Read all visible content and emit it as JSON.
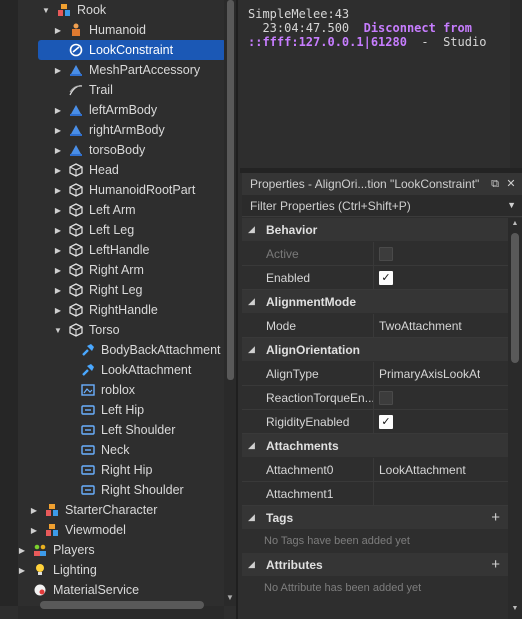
{
  "explorer": {
    "items": [
      {
        "label": "Rook",
        "arrow": "down",
        "icon": "model-icon",
        "indent": 56
      },
      {
        "label": "Humanoid",
        "arrow": "right",
        "icon": "humanoid-icon",
        "indent": 68
      },
      {
        "label": "LookConstraint",
        "arrow": "",
        "icon": "constraint-icon",
        "indent": 68,
        "selected": true
      },
      {
        "label": "MeshPartAccessory",
        "arrow": "right",
        "icon": "accessory-icon",
        "indent": 68
      },
      {
        "label": "Trail",
        "arrow": "",
        "icon": "trail-icon",
        "indent": 68
      },
      {
        "label": "leftArmBody",
        "arrow": "right",
        "icon": "accessory-icon",
        "indent": 68
      },
      {
        "label": "rightArmBody",
        "arrow": "right",
        "icon": "accessory-icon",
        "indent": 68
      },
      {
        "label": "torsoBody",
        "arrow": "right",
        "icon": "accessory-icon",
        "indent": 68
      },
      {
        "label": "Head",
        "arrow": "right",
        "icon": "part-icon",
        "indent": 68
      },
      {
        "label": "HumanoidRootPart",
        "arrow": "right",
        "icon": "part-icon",
        "indent": 68
      },
      {
        "label": "Left Arm",
        "arrow": "right",
        "icon": "part-icon",
        "indent": 68
      },
      {
        "label": "Left Leg",
        "arrow": "right",
        "icon": "part-icon",
        "indent": 68
      },
      {
        "label": "LeftHandle",
        "arrow": "right",
        "icon": "part-icon",
        "indent": 68
      },
      {
        "label": "Right Arm",
        "arrow": "right",
        "icon": "part-icon",
        "indent": 68
      },
      {
        "label": "Right Leg",
        "arrow": "right",
        "icon": "part-icon",
        "indent": 68
      },
      {
        "label": "RightHandle",
        "arrow": "right",
        "icon": "part-icon",
        "indent": 68
      },
      {
        "label": "Torso",
        "arrow": "down",
        "icon": "part-icon",
        "indent": 68
      },
      {
        "label": "BodyBackAttachment",
        "arrow": "",
        "icon": "attachment-icon",
        "indent": 80
      },
      {
        "label": "LookAttachment",
        "arrow": "",
        "icon": "attachment-icon",
        "indent": 80
      },
      {
        "label": "roblox",
        "arrow": "",
        "icon": "decal-icon",
        "indent": 80
      },
      {
        "label": "Left Hip",
        "arrow": "",
        "icon": "motor-icon",
        "indent": 80
      },
      {
        "label": "Left Shoulder",
        "arrow": "",
        "icon": "motor-icon",
        "indent": 80
      },
      {
        "label": "Neck",
        "arrow": "",
        "icon": "motor-icon",
        "indent": 80
      },
      {
        "label": "Right Hip",
        "arrow": "",
        "icon": "motor-icon",
        "indent": 80
      },
      {
        "label": "Right Shoulder",
        "arrow": "",
        "icon": "motor-icon",
        "indent": 80
      },
      {
        "label": "StarterCharacter",
        "arrow": "right",
        "icon": "model-icon",
        "indent": 44
      },
      {
        "label": "Viewmodel",
        "arrow": "right",
        "icon": "model-icon",
        "indent": 44
      },
      {
        "label": "Players",
        "arrow": "right",
        "icon": "players-icon",
        "indent": 32
      },
      {
        "label": "Lighting",
        "arrow": "right",
        "icon": "lighting-icon",
        "indent": 32
      },
      {
        "label": "MaterialService",
        "arrow": "",
        "icon": "material-icon",
        "indent": 32
      }
    ]
  },
  "output": {
    "lines": [
      {
        "text": "SimpleMelee:43",
        "warn": ""
      },
      {
        "text": "  23:04:47.500  ",
        "warn": "Disconnect from"
      },
      {
        "text": "",
        "warn": "::ffff:127.0.0.1|61280",
        "tail": "  -  Studio"
      }
    ]
  },
  "properties": {
    "title": "Properties - AlignOri...tion \"LookConstraint\"",
    "filter_placeholder": "Filter Properties (Ctrl+Shift+P)",
    "sections": [
      {
        "name": "Behavior",
        "rows": [
          {
            "name": "Active",
            "type": "check",
            "value": false,
            "dim": true
          },
          {
            "name": "Enabled",
            "type": "check",
            "value": true
          }
        ]
      },
      {
        "name": "AlignmentMode",
        "rows": [
          {
            "name": "Mode",
            "type": "text",
            "value": "TwoAttachment"
          }
        ]
      },
      {
        "name": "AlignOrientation",
        "rows": [
          {
            "name": "AlignType",
            "type": "text",
            "value": "PrimaryAxisLookAt"
          },
          {
            "name": "ReactionTorqueEn...",
            "type": "check",
            "value": false
          },
          {
            "name": "RigidityEnabled",
            "type": "check",
            "value": true
          }
        ]
      },
      {
        "name": "Attachments",
        "rows": [
          {
            "name": "Attachment0",
            "type": "text",
            "value": "LookAttachment"
          },
          {
            "name": "Attachment1",
            "type": "text",
            "value": ""
          }
        ]
      },
      {
        "name": "Tags",
        "plus": true,
        "note": "No Tags have been added yet"
      },
      {
        "name": "Attributes",
        "plus": true,
        "note": "No Attribute has been added yet"
      }
    ]
  },
  "colors": {
    "selected": "#1b58b5",
    "warn": "#c77dff"
  }
}
